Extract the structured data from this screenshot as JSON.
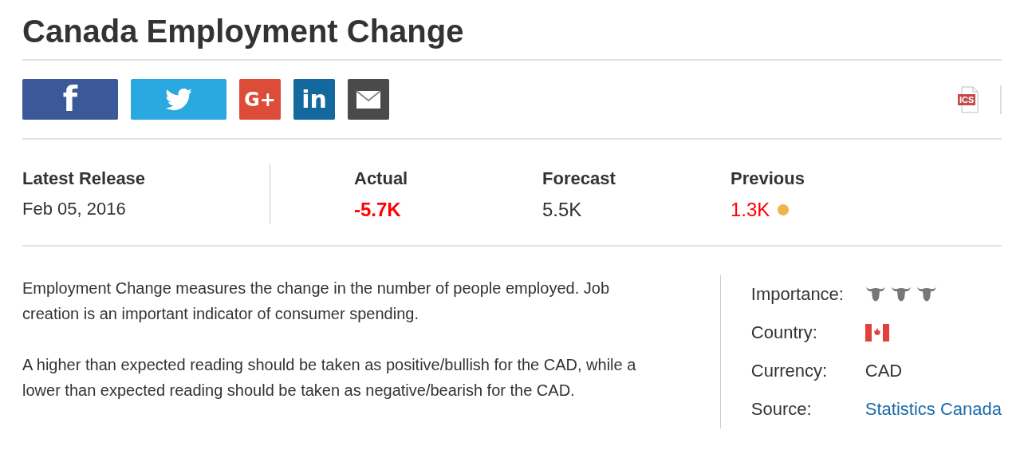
{
  "title": "Canada Employment Change",
  "share": [
    {
      "kind": "facebook",
      "label": "f"
    },
    {
      "kind": "twitter"
    },
    {
      "kind": "googleplus",
      "label": "G+"
    },
    {
      "kind": "linkedin",
      "label": "in"
    },
    {
      "kind": "email"
    }
  ],
  "calendar_file": {
    "label": "ICS"
  },
  "release": {
    "label": "Latest Release",
    "date": "Feb 05, 2016"
  },
  "metrics": [
    {
      "label": "Actual",
      "value": "-5.7K",
      "color": "#ff0000",
      "bold": true,
      "revised": false
    },
    {
      "label": "Forecast",
      "value": "5.5K",
      "color": "#333333",
      "bold": false,
      "revised": false
    },
    {
      "label": "Previous",
      "value": "1.3K",
      "color": "#ff0000",
      "bold": false,
      "revised": true
    }
  ],
  "description": [
    "Employment Change measures the change in the number of people employed. Job creation is an important indicator of consumer spending.",
    "A higher than expected reading should be taken as positive/bullish for the CAD, while a lower than expected reading should be taken as negative/bearish for the CAD."
  ],
  "details": [
    {
      "kind": "importance",
      "label": "Importance:",
      "stars": 3
    },
    {
      "kind": "flag",
      "label": "Country:"
    },
    {
      "kind": "text",
      "label": "Currency:",
      "value": "CAD"
    },
    {
      "kind": "link",
      "label": "Source:",
      "value": "Statistics Canada"
    }
  ]
}
